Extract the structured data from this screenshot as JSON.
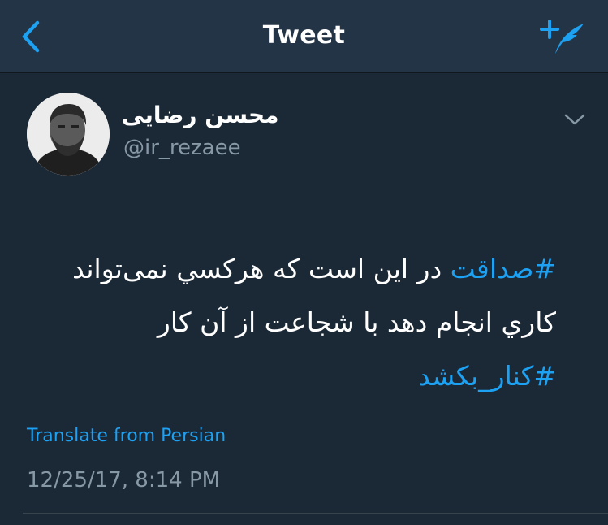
{
  "header": {
    "title": "Tweet",
    "back_icon": "chevron-left-icon",
    "compose_icon": "compose-tweet-icon"
  },
  "tweet": {
    "author": {
      "display_name": "محسن رضایی",
      "handle": "@ir_rezaee"
    },
    "lines": [
      [
        {
          "text": "#صداقت",
          "hashtag": true
        },
        {
          "text": " در این است که هرکسي نمی‌تواند",
          "hashtag": false
        }
      ],
      [
        {
          "text": "کاري انجام دهد با شجاعت از آن کار",
          "hashtag": false
        }
      ],
      [
        {
          "text": "#کنار_بکشد",
          "hashtag": true
        }
      ]
    ],
    "translate_label": "Translate from Persian",
    "timestamp": "12/25/17, 8:14 PM"
  },
  "colors": {
    "background": "#1b2836",
    "header_bg": "#243447",
    "accent": "#1da1f2",
    "secondary_text": "#8899a6"
  }
}
